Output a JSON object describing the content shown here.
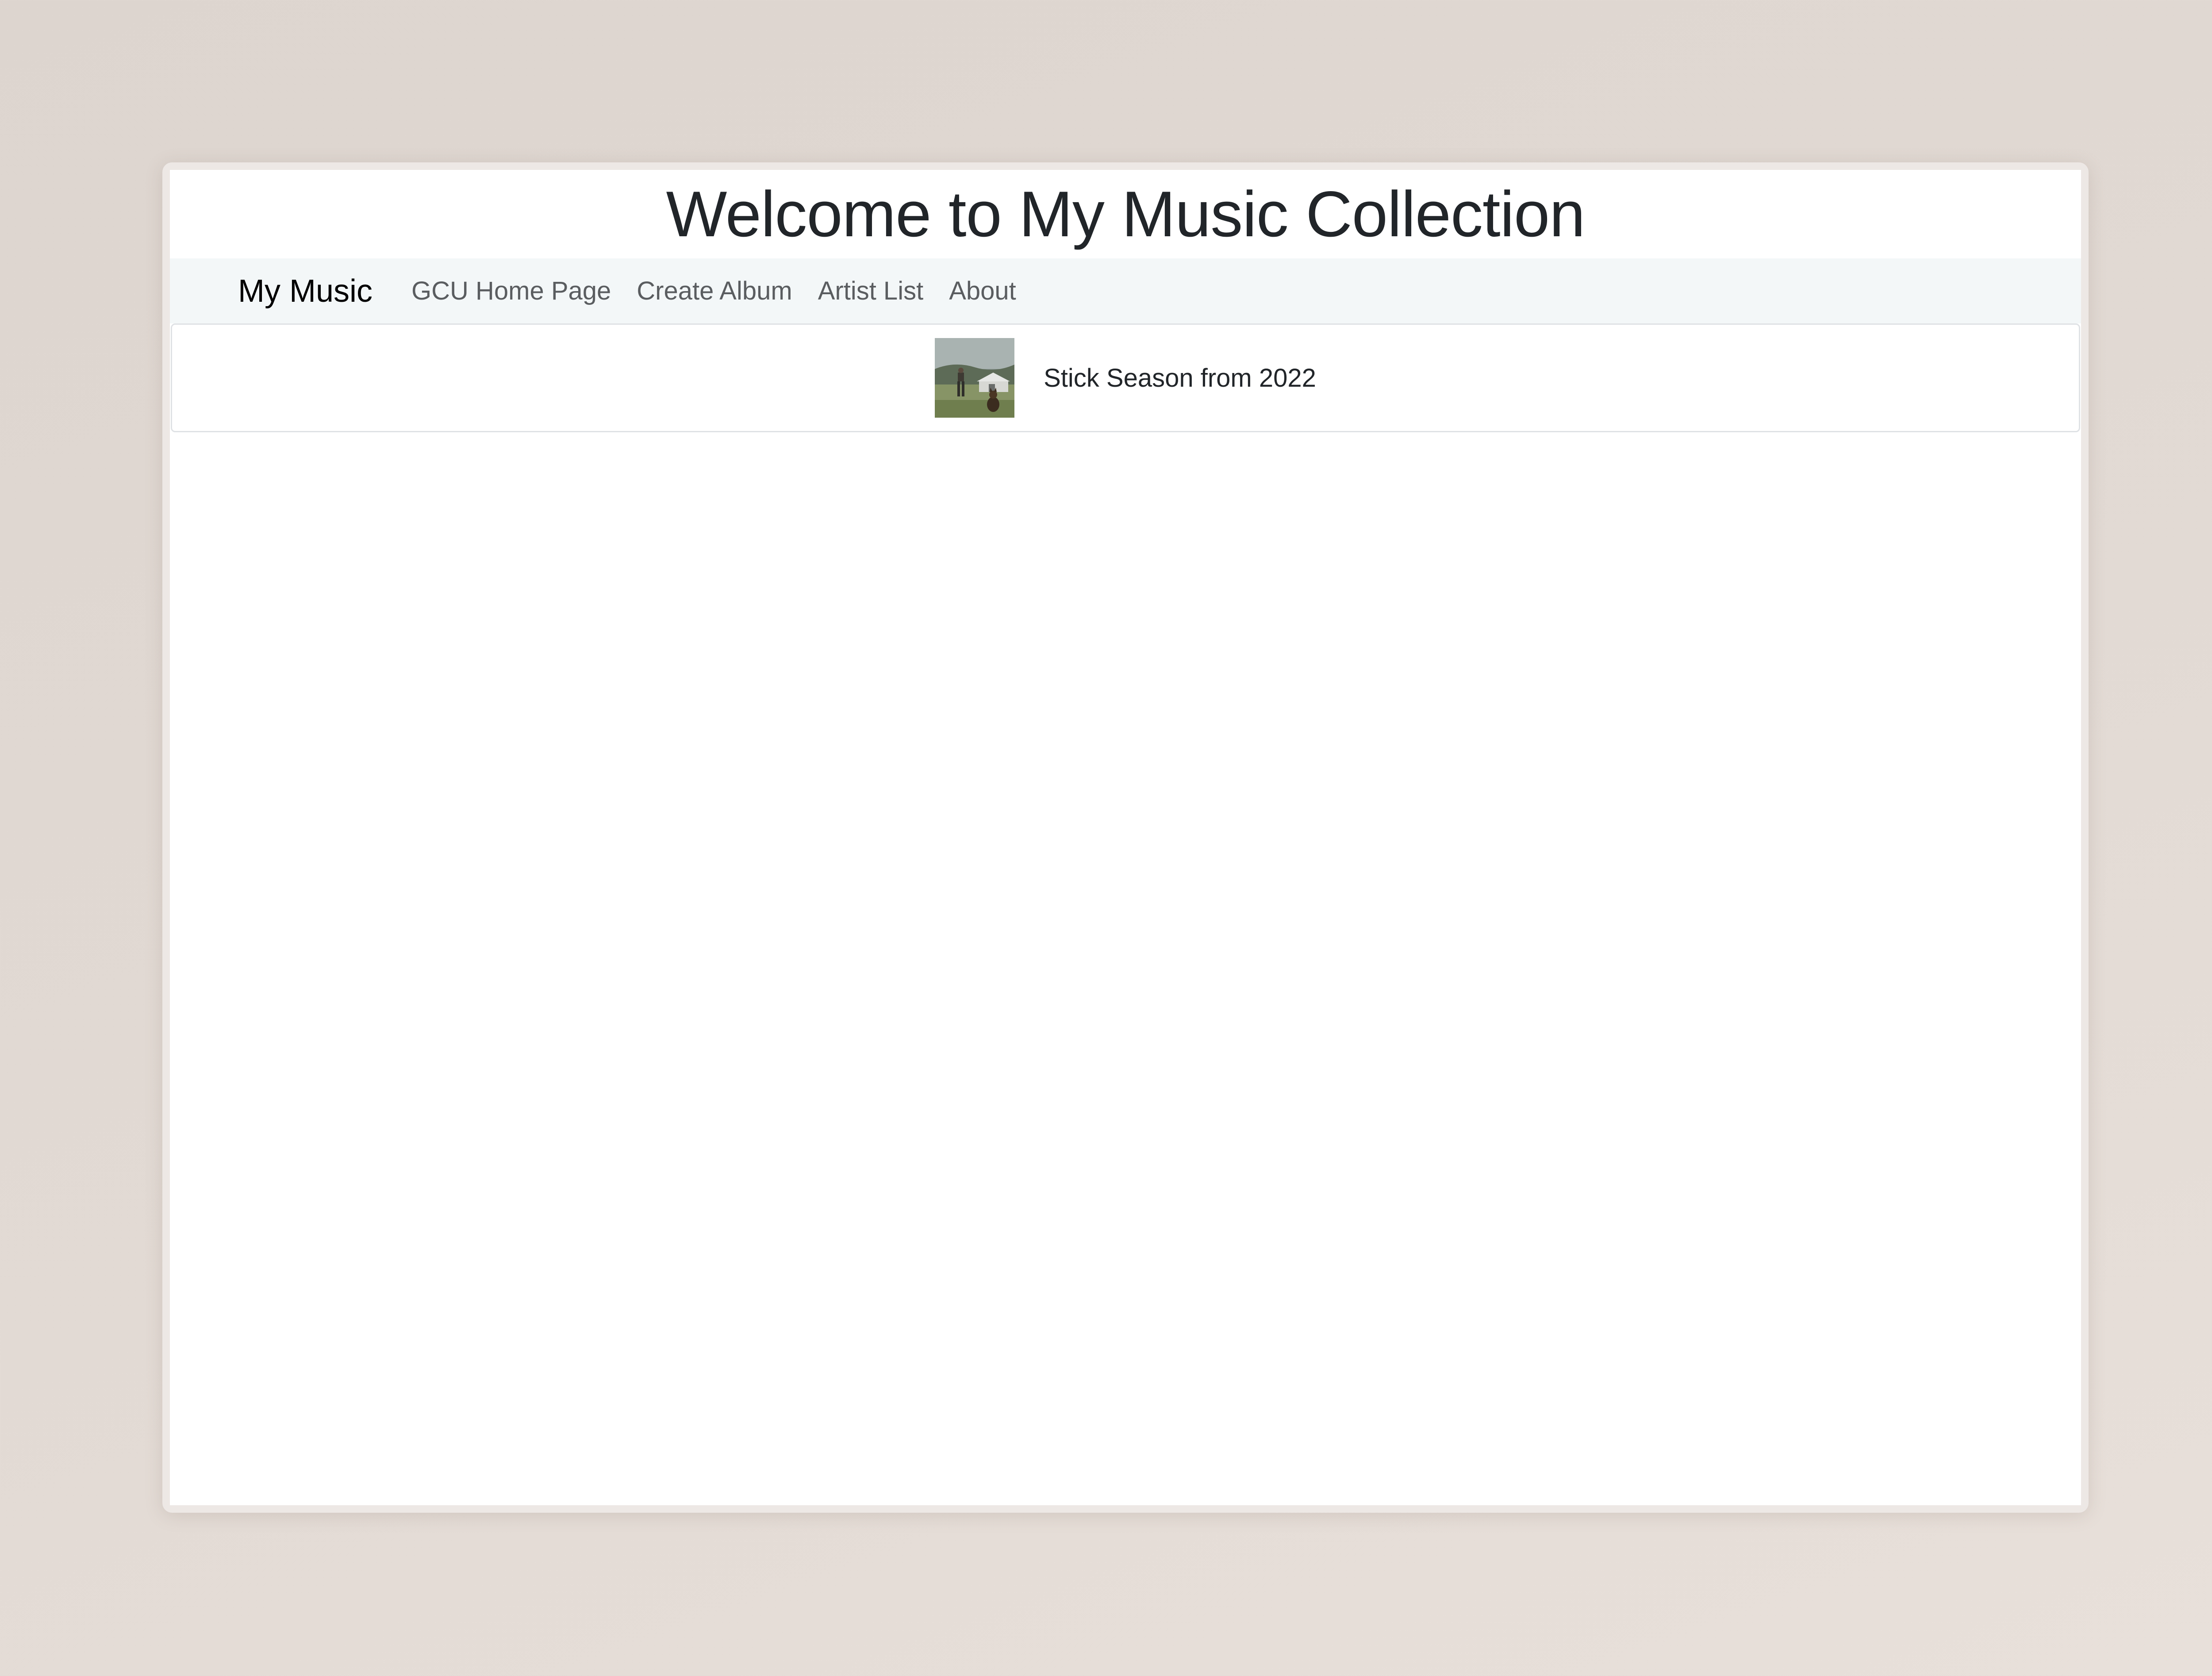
{
  "page": {
    "heading": "Welcome to My Music Collection"
  },
  "navbar": {
    "brand": "My Music",
    "links": [
      {
        "label": "GCU Home Page"
      },
      {
        "label": "Create Album"
      },
      {
        "label": "Artist List"
      },
      {
        "label": "About"
      }
    ]
  },
  "albums": [
    {
      "title_line": "Stick Season from 2022",
      "cover_icon": "album-cover-image"
    }
  ],
  "colors": {
    "heading_text": "#212529",
    "navbar_background": "#f3f7f8",
    "nav_link_text": "#5a5d60",
    "card_border": "#dfe2e5"
  }
}
